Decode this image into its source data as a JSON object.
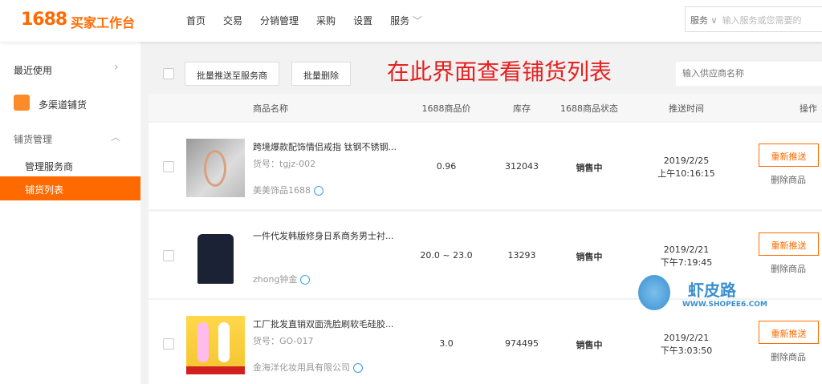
{
  "header": {
    "logo": "1688",
    "logo_sub": "买家工作台",
    "nav": [
      "首页",
      "交易",
      "分销管理",
      "采购",
      "设置",
      "服务"
    ],
    "service_select": "服务",
    "service_placeholder": "输入服务或您需要的"
  },
  "sidebar": {
    "recent": "最近使用",
    "multichannel": "多渠道铺货",
    "group": "铺货管理",
    "items": [
      "管理服务商",
      "铺货列表"
    ]
  },
  "toolbar": {
    "batch_push": "批量推送至服务商",
    "batch_delete": "批量删除",
    "annotation": "在此界面查看铺货列表",
    "supplier_placeholder": "输入供应商名称"
  },
  "table": {
    "headers": [
      "商品名称",
      "1688商品价",
      "库存",
      "1688商品状态",
      "推送时间",
      "操作"
    ],
    "rows": [
      {
        "title": "跨境爆款配饰情侣戒指 钛钢不锈钢...",
        "sku": "货号：tgjz-002",
        "shop": "美美饰品1688",
        "price": "0.96",
        "stock": "312043",
        "status": "销售中",
        "date": "2019/2/25",
        "time": "上午10:16:15",
        "action": "重新推送",
        "delete": "删除商品"
      },
      {
        "title": "一件代发韩版修身日系商务男士衬...",
        "sku": "",
        "shop": "zhong钟金",
        "price": "20.0 ~ 23.0",
        "stock": "13293",
        "status": "销售中",
        "date": "2019/2/21",
        "time": "下午7:19:45",
        "action": "重新推送",
        "delete": "删除商品"
      },
      {
        "title": "工厂批发直销双面洗脸刷软毛硅胶...",
        "sku": "货号：GO-017",
        "shop": "金海洋化妆用具有限公司",
        "price": "3.0",
        "stock": "974495",
        "status": "销售中",
        "date": "2019/2/21",
        "time": "下午3:03:50",
        "action": "重新推送",
        "delete": "删除商品"
      }
    ]
  },
  "watermark": {
    "name": "虾皮路",
    "url": "WWW.SHOPEE6.COM"
  },
  "colors": {
    "accent": "#ff6a00",
    "annotation": "#e62020"
  }
}
